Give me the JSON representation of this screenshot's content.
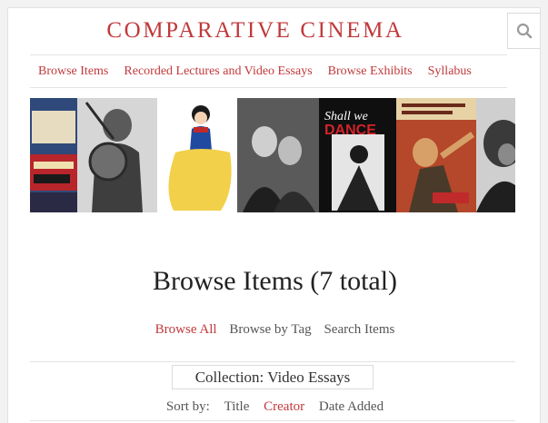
{
  "site": {
    "title": "COMPARATIVE CINEMA"
  },
  "nav": {
    "items": [
      "Browse Items",
      "Recorded Lectures and Video Essays",
      "Browse Exhibits",
      "Syllabus"
    ]
  },
  "banner": {
    "panel_5_text": "Shall we DANCE"
  },
  "main": {
    "heading": "Browse Items (7 total)",
    "subnav": [
      "Browse All",
      "Browse by Tag",
      "Search Items"
    ],
    "collection": "Collection: Video Essays",
    "sort": {
      "label": "Sort by:",
      "options": [
        "Title",
        "Creator",
        "Date Added"
      ]
    }
  },
  "colors": {
    "accent": "#c0393b"
  }
}
